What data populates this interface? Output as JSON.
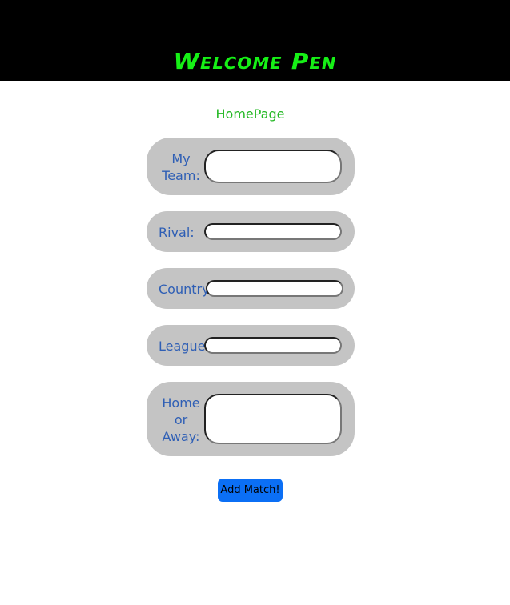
{
  "header": {
    "title": "Welcome Pen"
  },
  "nav": {
    "home_link": "HomePage"
  },
  "form": {
    "my_team": {
      "label": "My Team:",
      "value": ""
    },
    "rival": {
      "label": "Rival:",
      "value": ""
    },
    "country": {
      "label": "Country:",
      "value": ""
    },
    "league": {
      "label": "League:",
      "value": ""
    },
    "home_or_away": {
      "label": "Home or Away:",
      "value": ""
    },
    "submit_label": "Add Match!"
  },
  "colors": {
    "header_bg": "#000000",
    "title": "#16f016",
    "link": "#23b823",
    "row_bg": "#c4c4c4",
    "label": "#2f5fb5",
    "button": "#0b6ff5"
  }
}
